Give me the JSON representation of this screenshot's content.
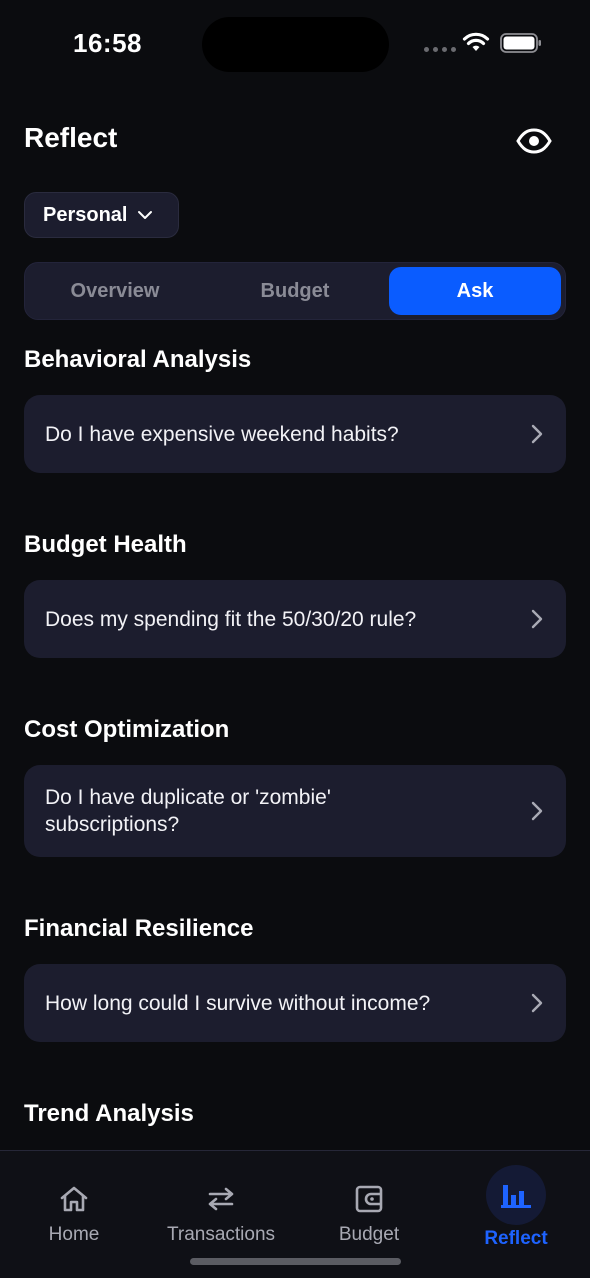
{
  "status_bar": {
    "time": "16:58"
  },
  "header": {
    "title": "Reflect",
    "visibility_icon": "eye-icon"
  },
  "scope": {
    "selected": "Personal"
  },
  "segmented": {
    "tabs": [
      "Overview",
      "Budget",
      "Ask"
    ],
    "selected": "Ask"
  },
  "sections": [
    {
      "heading": "Behavioral Analysis",
      "question": "Do I have expensive weekend habits?"
    },
    {
      "heading": "Budget Health",
      "question": "Does my spending fit the 50/30/20 rule?"
    },
    {
      "heading": "Cost Optimization",
      "question": "Do I have duplicate or 'zombie' subscriptions?"
    },
    {
      "heading": "Financial Resilience",
      "question": "How long could I survive without income?"
    },
    {
      "heading": "Trend Analysis"
    }
  ],
  "tab_bar": {
    "items": [
      {
        "label": "Home",
        "icon": "home-icon"
      },
      {
        "label": "Transactions",
        "icon": "transfer-arrows-icon"
      },
      {
        "label": "Budget",
        "icon": "wallet-icon"
      },
      {
        "label": "Reflect",
        "icon": "bar-chart-icon"
      }
    ],
    "active": "Reflect"
  },
  "colors": {
    "accent": "#0a5cff",
    "background": "#0b0c0f",
    "card": "#1c1d2e",
    "active_tab_label": "#1e63ff"
  }
}
